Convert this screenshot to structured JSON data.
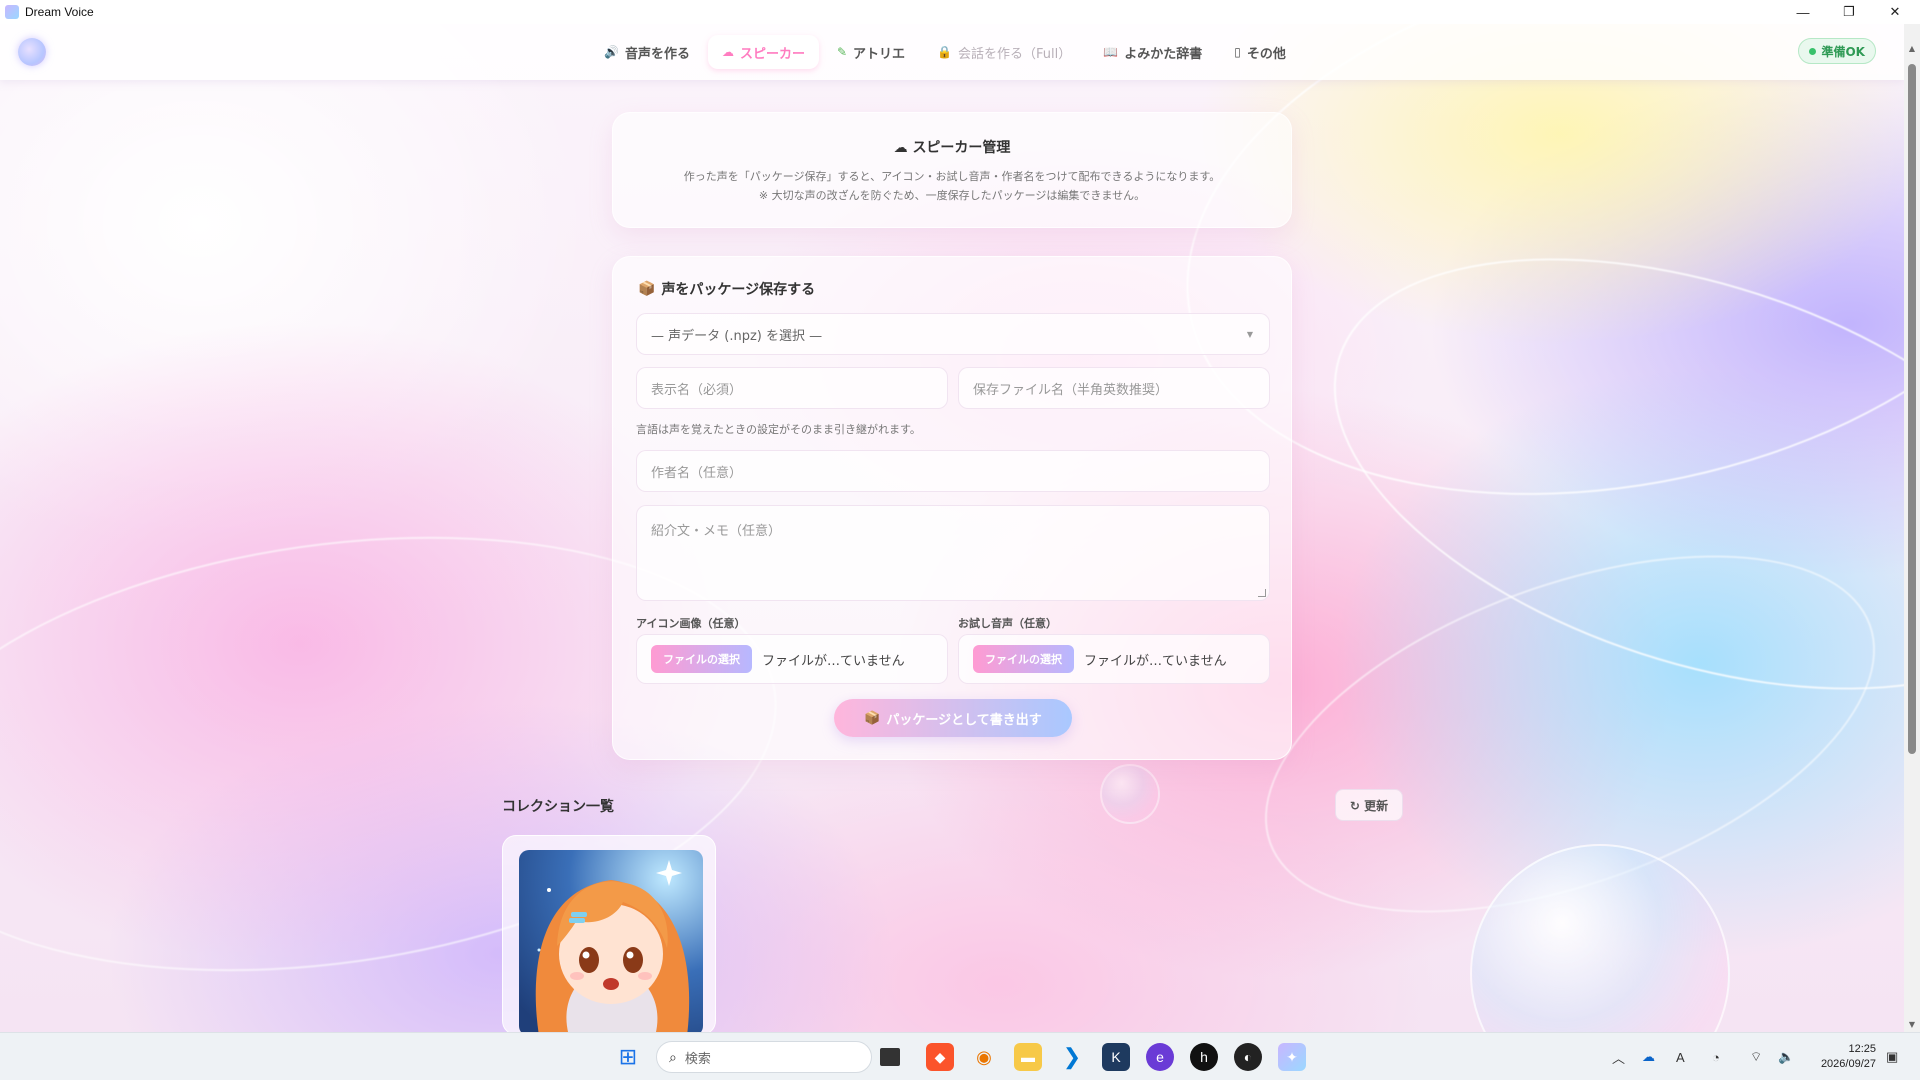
{
  "window": {
    "title": "Dream Voice",
    "minimize": "—",
    "maximize": "❐",
    "close": "✕"
  },
  "nav": {
    "tabs": [
      {
        "icon": "🔊",
        "label": "音声を作る"
      },
      {
        "icon": "☁",
        "label": "スピーカー"
      },
      {
        "icon": "✎",
        "label": "アトリエ"
      },
      {
        "icon": "🔒",
        "label": "会話を作る（Full）"
      },
      {
        "icon": "📖",
        "label": "よみかた辞書"
      },
      {
        "icon": "▯",
        "label": "その他"
      }
    ],
    "status": "準備OK"
  },
  "info": {
    "title": "スピーカー管理",
    "line1": "作った声を「パッケージ保存」すると、アイコン・お試し音声・作者名をつけて配布できるようになります。",
    "line2": "※ 大切な声の改ざんを防ぐため、一度保存したパッケージは編集できません。"
  },
  "form": {
    "title": "声をパッケージ保存する",
    "voice_select": "— 声データ (.npz) を選択 —",
    "display_name_placeholder": "表示名（必須）",
    "file_name_placeholder": "保存ファイル名（半角英数推奨）",
    "hint": "言語は声を覚えたときの設定がそのまま引き継がれます。",
    "author_placeholder": "作者名（任意）",
    "memo_placeholder": "紹介文・メモ（任意）",
    "icon_label": "アイコン画像（任意）",
    "sample_label": "お試し音声（任意）",
    "file_button": "ファイルの選択",
    "no_file": "ファイルが…ていません",
    "export_button": "パッケージとして書き出す"
  },
  "collection": {
    "title": "コレクション一覧",
    "refresh": "↻ 更新"
  },
  "taskbar": {
    "search_placeholder": "検索",
    "time": "12:25",
    "date": "2026/09/27"
  },
  "colors": {
    "accent": "#ff7cc0",
    "status_green": "#39c16b"
  }
}
